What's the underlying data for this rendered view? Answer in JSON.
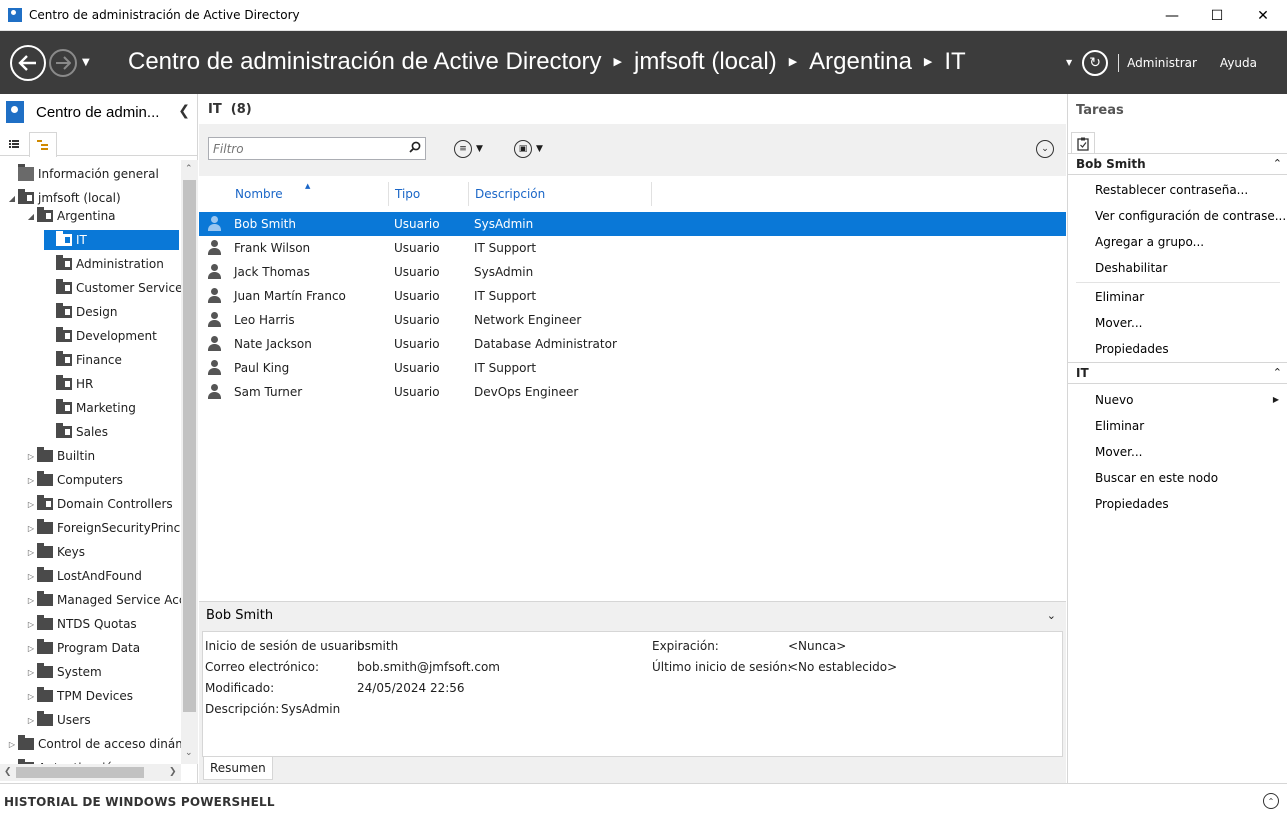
{
  "window": {
    "title": "Centro de administración de Active Directory"
  },
  "header": {
    "breadcrumb": [
      "Centro de administración de Active Directory",
      "jmfsoft (local)",
      "Argentina",
      "IT"
    ],
    "manage_label": "Administrar",
    "help_label": "Ayuda"
  },
  "nav": {
    "title": "Centro de admin...",
    "tree": [
      {
        "label": "Información general",
        "level": 0,
        "kind": "overview",
        "expander": ""
      },
      {
        "label": "jmfsoft (local)",
        "level": 0,
        "kind": "domain",
        "expander": "◢"
      },
      {
        "label": "Argentina",
        "level": 1,
        "kind": "ou",
        "expander": "◢"
      },
      {
        "label": "IT",
        "level": 2,
        "kind": "ou",
        "expander": "",
        "selected": true
      },
      {
        "label": "Administration",
        "level": 2,
        "kind": "ou",
        "expander": ""
      },
      {
        "label": "Customer Service",
        "level": 2,
        "kind": "ou",
        "expander": ""
      },
      {
        "label": "Design",
        "level": 2,
        "kind": "ou",
        "expander": ""
      },
      {
        "label": "Development",
        "level": 2,
        "kind": "ou",
        "expander": ""
      },
      {
        "label": "Finance",
        "level": 2,
        "kind": "ou",
        "expander": ""
      },
      {
        "label": "HR",
        "level": 2,
        "kind": "ou",
        "expander": ""
      },
      {
        "label": "Marketing",
        "level": 2,
        "kind": "ou",
        "expander": ""
      },
      {
        "label": "Sales",
        "level": 2,
        "kind": "ou",
        "expander": ""
      },
      {
        "label": "Builtin",
        "level": 1,
        "kind": "folder",
        "expander": "▷"
      },
      {
        "label": "Computers",
        "level": 1,
        "kind": "folder",
        "expander": "▷"
      },
      {
        "label": "Domain Controllers",
        "level": 1,
        "kind": "ou",
        "expander": "▷"
      },
      {
        "label": "ForeignSecurityPrincip",
        "level": 1,
        "kind": "folder",
        "expander": "▷"
      },
      {
        "label": "Keys",
        "level": 1,
        "kind": "folder",
        "expander": "▷"
      },
      {
        "label": "LostAndFound",
        "level": 1,
        "kind": "folder",
        "expander": "▷"
      },
      {
        "label": "Managed Service Acco",
        "level": 1,
        "kind": "folder",
        "expander": "▷"
      },
      {
        "label": "NTDS Quotas",
        "level": 1,
        "kind": "folder",
        "expander": "▷"
      },
      {
        "label": "Program Data",
        "level": 1,
        "kind": "folder",
        "expander": "▷"
      },
      {
        "label": "System",
        "level": 1,
        "kind": "folder",
        "expander": "▷"
      },
      {
        "label": "TPM Devices",
        "level": 1,
        "kind": "folder",
        "expander": "▷"
      },
      {
        "label": "Users",
        "level": 1,
        "kind": "folder",
        "expander": "▷"
      },
      {
        "label": "Control de acceso dinámi",
        "level": 0,
        "kind": "folder",
        "expander": "▷"
      },
      {
        "label": "Autenticación",
        "level": 0,
        "kind": "folder",
        "expander": "▷"
      }
    ]
  },
  "list": {
    "title": "IT",
    "count": "(8)",
    "filter_placeholder": "Filtro",
    "columns": [
      "Nombre",
      "Tipo",
      "Descripción"
    ],
    "rows": [
      {
        "name": "Bob Smith",
        "type": "Usuario",
        "description": "SysAdmin",
        "selected": true
      },
      {
        "name": "Frank Wilson",
        "type": "Usuario",
        "description": "IT Support"
      },
      {
        "name": "Jack Thomas",
        "type": "Usuario",
        "description": "SysAdmin"
      },
      {
        "name": "Juan Martín Franco",
        "type": "Usuario",
        "description": "IT Support"
      },
      {
        "name": "Leo Harris",
        "type": "Usuario",
        "description": "Network Engineer"
      },
      {
        "name": "Nate Jackson",
        "type": "Usuario",
        "description": "Database Administrator"
      },
      {
        "name": "Paul King",
        "type": "Usuario",
        "description": "IT Support"
      },
      {
        "name": "Sam Turner",
        "type": "Usuario",
        "description": "DevOps Engineer"
      }
    ]
  },
  "details": {
    "header": "Bob Smith",
    "logon_label": "Inicio de sesión de usuario",
    "logon_value": "bsmith",
    "email_label": "Correo electrónico:",
    "email_value": "bob.smith@jmfsoft.com",
    "modified_label": "Modificado:",
    "modified_value": "24/05/2024 22:56",
    "description_label": "Descripción:",
    "description_value": "SysAdmin",
    "expiration_label": "Expiración:",
    "expiration_value": "<Nunca>",
    "last_logon_label": "Último inicio de sesión:",
    "last_logon_value": "<No establecido>",
    "tab": "Resumen"
  },
  "tasks": {
    "title": "Tareas",
    "section1": "Bob Smith",
    "section1_items": [
      "Restablecer contraseña...",
      "Ver configuración de contrase...",
      "Agregar a grupo...",
      "Deshabilitar",
      "Eliminar",
      "Mover...",
      "Propiedades"
    ],
    "section2": "IT",
    "section2_items": [
      "Nuevo",
      "Eliminar",
      "Mover...",
      "Buscar en este nodo",
      "Propiedades"
    ]
  },
  "powershell": {
    "label": "HISTORIAL DE WINDOWS POWERSHELL"
  },
  "colors": {
    "header_bg": "#3c3c3c",
    "selection": "#0a78d7",
    "link": "#1a66c7"
  }
}
